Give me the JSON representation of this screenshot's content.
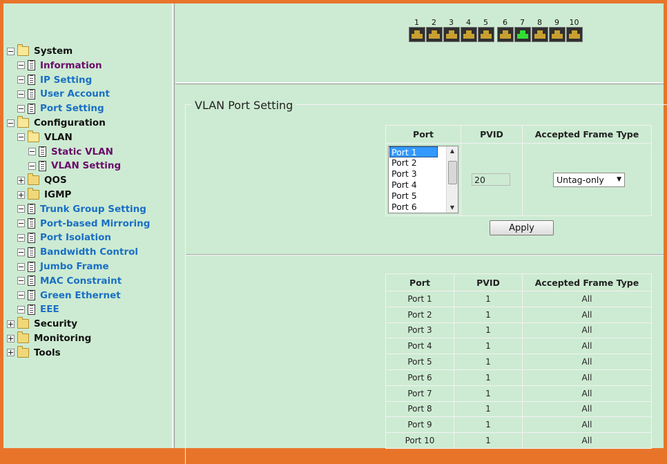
{
  "tree": [
    {
      "label": "System",
      "level": 0,
      "toggle": "minus",
      "icon": "folder-open",
      "color": "black"
    },
    {
      "label": "Information",
      "level": 1,
      "toggle": "minus",
      "icon": "doc",
      "color": "purple"
    },
    {
      "label": "IP Setting",
      "level": 1,
      "toggle": "minus",
      "icon": "doc",
      "color": "blue"
    },
    {
      "label": "User Account",
      "level": 1,
      "toggle": "minus",
      "icon": "doc",
      "color": "blue"
    },
    {
      "label": "Port Setting",
      "level": 1,
      "toggle": "minus",
      "icon": "doc",
      "color": "blue"
    },
    {
      "label": "Configuration",
      "level": 0,
      "toggle": "minus",
      "icon": "folder-open",
      "color": "black"
    },
    {
      "label": "VLAN",
      "level": 1,
      "toggle": "minus",
      "icon": "folder-open",
      "color": "black"
    },
    {
      "label": "Static VLAN",
      "level": 2,
      "toggle": "minus",
      "icon": "doc",
      "color": "purple"
    },
    {
      "label": "VLAN Setting",
      "level": 2,
      "toggle": "minus",
      "icon": "doc",
      "color": "purple"
    },
    {
      "label": "QOS",
      "level": 1,
      "toggle": "plus",
      "icon": "folder",
      "color": "black"
    },
    {
      "label": "IGMP",
      "level": 1,
      "toggle": "plus",
      "icon": "folder",
      "color": "black"
    },
    {
      "label": "Trunk Group Setting",
      "level": 1,
      "toggle": "minus",
      "icon": "doc",
      "color": "blue"
    },
    {
      "label": "Port-based Mirroring",
      "level": 1,
      "toggle": "minus",
      "icon": "doc",
      "color": "blue"
    },
    {
      "label": "Port Isolation",
      "level": 1,
      "toggle": "minus",
      "icon": "doc",
      "color": "blue"
    },
    {
      "label": "Bandwidth Control",
      "level": 1,
      "toggle": "minus",
      "icon": "doc",
      "color": "blue"
    },
    {
      "label": "Jumbo Frame",
      "level": 1,
      "toggle": "minus",
      "icon": "doc",
      "color": "blue"
    },
    {
      "label": "MAC Constraint",
      "level": 1,
      "toggle": "minus",
      "icon": "doc",
      "color": "blue"
    },
    {
      "label": "Green Ethernet",
      "level": 1,
      "toggle": "minus",
      "icon": "doc",
      "color": "blue"
    },
    {
      "label": "EEE",
      "level": 1,
      "toggle": "minus",
      "icon": "doc",
      "color": "blue"
    },
    {
      "label": "Security",
      "level": 0,
      "toggle": "plus",
      "icon": "folder",
      "color": "black"
    },
    {
      "label": "Monitoring",
      "level": 0,
      "toggle": "plus",
      "icon": "folder",
      "color": "black"
    },
    {
      "label": "Tools",
      "level": 0,
      "toggle": "plus",
      "icon": "folder",
      "color": "black"
    }
  ],
  "ports": [
    {
      "num": "1",
      "active": false
    },
    {
      "num": "2",
      "active": false
    },
    {
      "num": "3",
      "active": false
    },
    {
      "num": "4",
      "active": false
    },
    {
      "num": "5",
      "active": false
    },
    {
      "num": "6",
      "active": false
    },
    {
      "num": "7",
      "active": true
    },
    {
      "num": "8",
      "active": false
    },
    {
      "num": "9",
      "active": false
    },
    {
      "num": "10",
      "active": false
    }
  ],
  "section_title": "VLAN Port Setting",
  "settings": {
    "headers": [
      "Port",
      "PVID",
      "Accepted Frame Type"
    ],
    "port_options": [
      "Port 1",
      "Port 2",
      "Port 3",
      "Port 4",
      "Port 5",
      "Port 6"
    ],
    "selected_port": "Port 1",
    "pvid_value": "20",
    "frame_type": "Untag-only",
    "apply_label": "Apply"
  },
  "status_table": {
    "headers": [
      "Port",
      "PVID",
      "Accepted Frame Type"
    ],
    "rows": [
      [
        "Port 1",
        "1",
        "All"
      ],
      [
        "Port 2",
        "1",
        "All"
      ],
      [
        "Port 3",
        "1",
        "All"
      ],
      [
        "Port 4",
        "1",
        "All"
      ],
      [
        "Port 5",
        "1",
        "All"
      ],
      [
        "Port 6",
        "1",
        "All"
      ],
      [
        "Port 7",
        "1",
        "All"
      ],
      [
        "Port 8",
        "1",
        "All"
      ],
      [
        "Port 9",
        "1",
        "All"
      ],
      [
        "Port 10",
        "1",
        "All"
      ]
    ]
  },
  "colors": {
    "background": "#cdebd2",
    "border": "#e8742a",
    "link_blue": "#1a6fc4",
    "link_purple": "#6a0a6a",
    "port_active": "#33dd33"
  }
}
